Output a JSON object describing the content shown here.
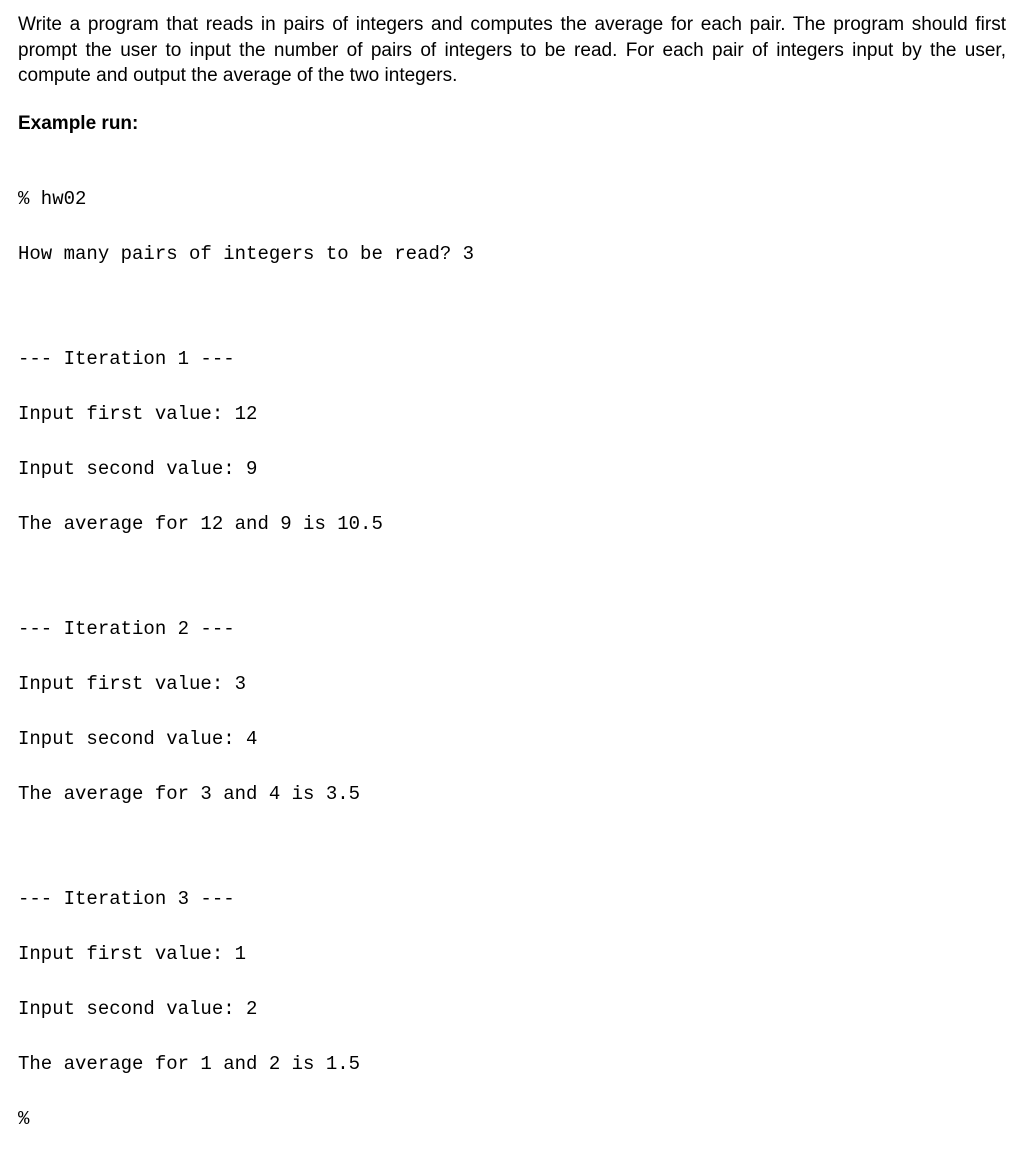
{
  "description": "Write a program that reads in pairs of integers and computes the average for each pair. The program should first prompt the user to input the number of pairs of integers to be read. For each pair of integers input by the user, compute and output the average of the two integers.",
  "example_heading": "Example run:",
  "terminal": {
    "invoke": "% hw02",
    "prompt_pairs": "How many pairs of integers to be read? 3",
    "iterations": [
      {
        "header": "--- Iteration 1 ---",
        "first": "Input first value: 12",
        "second": "Input second value: 9",
        "result": "The average for 12 and 9 is 10.5"
      },
      {
        "header": "--- Iteration 2 ---",
        "first": "Input first value: 3",
        "second": "Input second value: 4",
        "result": "The average for 3 and 4 is 3.5"
      },
      {
        "header": "--- Iteration 3 ---",
        "first": "Input first value: 1",
        "second": "Input second value: 2",
        "result": "The average for 1 and 2 is 1.5"
      }
    ],
    "end_prompt": "%"
  }
}
